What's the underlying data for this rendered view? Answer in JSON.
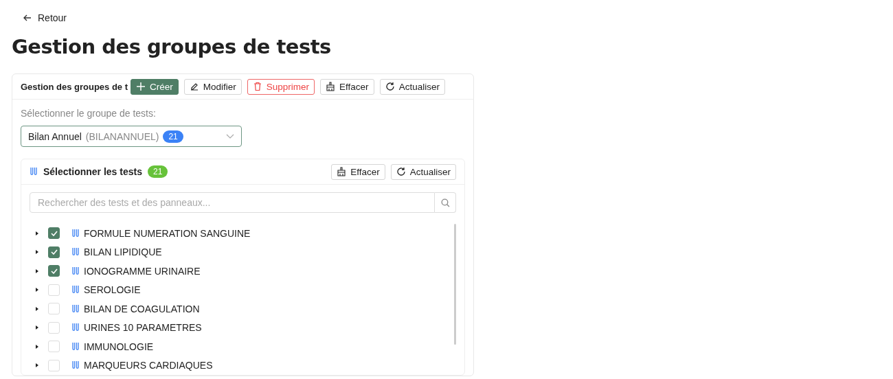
{
  "back_link": "Retour",
  "page_title": "Gestion des groupes de tests",
  "card": {
    "title": "Gestion des groupes de t",
    "buttons": [
      {
        "label": "Créer",
        "kind": "create"
      },
      {
        "label": "Modifier",
        "kind": "edit"
      },
      {
        "label": "Supprimer",
        "kind": "delete"
      },
      {
        "label": "Effacer",
        "kind": "clear"
      },
      {
        "label": "Actualiser",
        "kind": "refresh"
      }
    ],
    "select_label": "Sélectionner le groupe de tests:",
    "select": {
      "value": "Bilan Annuel",
      "code": "(BILANANNUEL)",
      "count": "21"
    },
    "tests_panel": {
      "title": "Sélectionner les tests",
      "count": "21",
      "buttons": [
        {
          "label": "Effacer",
          "kind": "clear"
        },
        {
          "label": "Actualiser",
          "kind": "refresh"
        }
      ],
      "search": {
        "placeholder": "Rechercher des tests et des panneaux..."
      },
      "items": [
        {
          "label": "FORMULE NUMERATION SANGUINE",
          "checked": true
        },
        {
          "label": "BILAN LIPIDIQUE",
          "checked": true
        },
        {
          "label": "IONOGRAMME URINAIRE",
          "checked": true
        },
        {
          "label": "SEROLOGIE",
          "checked": false
        },
        {
          "label": "BILAN DE COAGULATION",
          "checked": false
        },
        {
          "label": "URINES 10 PARAMETRES",
          "checked": false
        },
        {
          "label": "IMMUNOLOGIE",
          "checked": false
        },
        {
          "label": "MARQUEURS CARDIAQUES",
          "checked": false
        }
      ]
    }
  }
}
